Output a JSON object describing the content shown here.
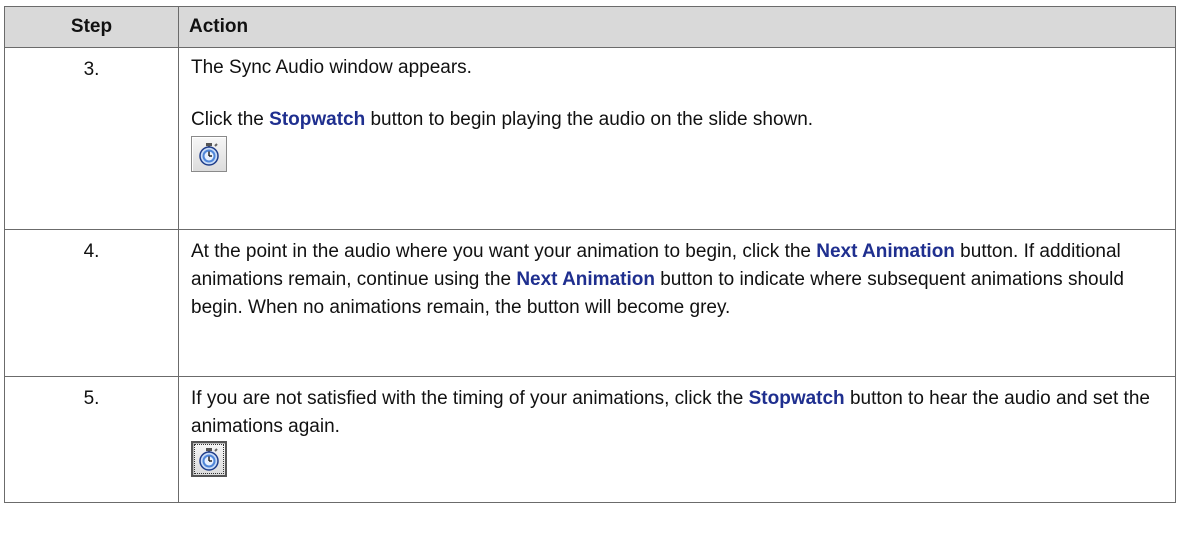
{
  "table": {
    "headers": {
      "step": "Step",
      "action": "Action"
    },
    "rows": [
      {
        "step": "3.",
        "line1": "The Sync Audio window appears.",
        "p2_pre": "Click the ",
        "p2_kw": "Stopwatch",
        "p2_post": " button to begin playing the audio on the slide shown.",
        "icon": "stopwatch-icon"
      },
      {
        "step": "4.",
        "t1": "At the point in the audio where you want your animation to begin, click the ",
        "kw1": "Next Animation",
        "t2": " button.  If additional animations remain, continue using the ",
        "kw2": "Next Animation",
        "t3": " button to indicate where subsequent animations should begin.  When no animations remain, the button will become grey."
      },
      {
        "step": "5.",
        "t1": "If you are not satisfied with the timing of your animations, click the ",
        "kw1": "Stopwatch",
        "t2": " button to hear the audio and set the animations again.",
        "icon": "stopwatch-icon"
      }
    ]
  },
  "colors": {
    "header_bg": "#d9d9d9",
    "keyword": "#1f2f8f",
    "border": "#6b6b6b"
  }
}
